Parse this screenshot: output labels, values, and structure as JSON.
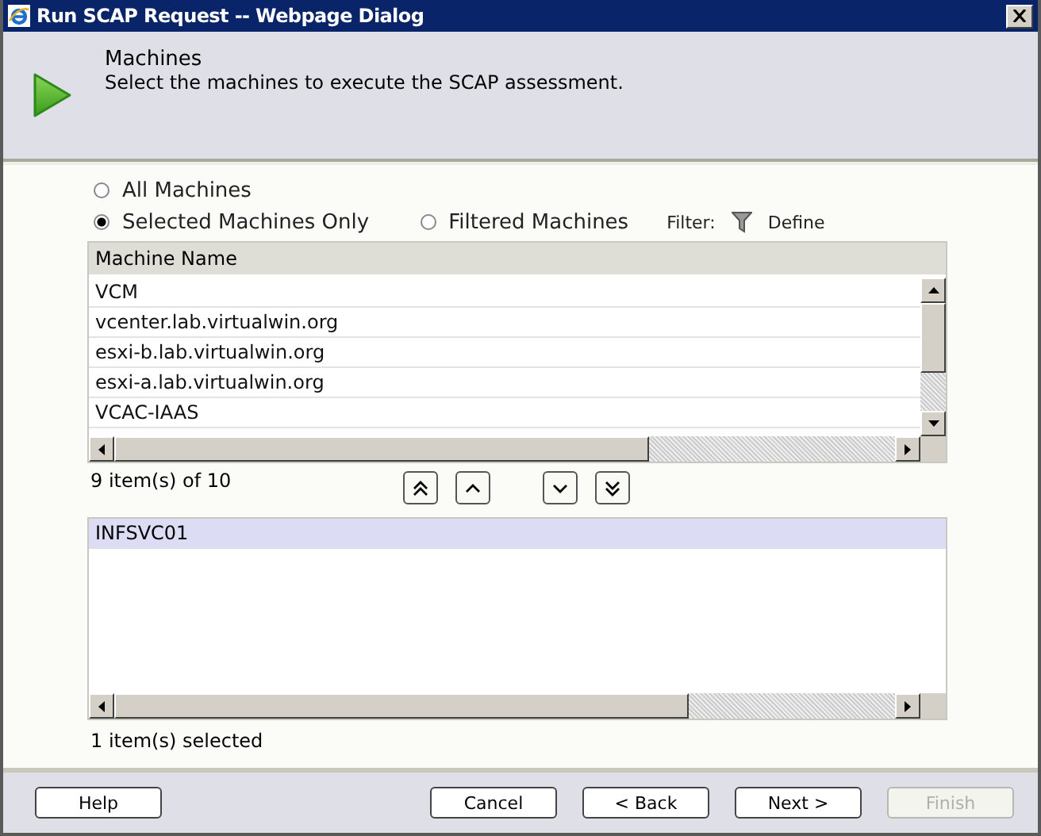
{
  "window": {
    "title": "Run SCAP Request -- Webpage Dialog"
  },
  "header": {
    "title": "Machines",
    "subtitle": "Select the machines to execute the SCAP assessment."
  },
  "scope_options": [
    {
      "label": "All Machines",
      "selected": false
    },
    {
      "label": "Selected Machines Only",
      "selected": true
    },
    {
      "label": "Filtered Machines",
      "selected": false
    }
  ],
  "filter": {
    "label": "Filter:",
    "link": "Define"
  },
  "table": {
    "columns": [
      "Machine Name"
    ],
    "rows": [
      {
        "name": "VCM"
      },
      {
        "name": "vcenter.lab.virtualwin.org"
      },
      {
        "name": "esxi-b.lab.virtualwin.org"
      },
      {
        "name": "esxi-a.lab.virtualwin.org"
      },
      {
        "name": "VCAC-IAAS"
      }
    ]
  },
  "available_count": "9 item(s) of 10",
  "move_buttons": [
    {
      "kind": "top"
    },
    {
      "kind": "up"
    },
    {
      "kind": "down"
    },
    {
      "kind": "bottom"
    }
  ],
  "selected_list": {
    "items": [
      {
        "name": "INFSVC01",
        "selected": true
      }
    ],
    "count": "1 item(s) selected"
  },
  "buttons": [
    {
      "label": "Help",
      "disabled": false
    },
    {
      "label": "Cancel",
      "disabled": false
    },
    {
      "label": "< Back",
      "disabled": false
    },
    {
      "label": "Next >",
      "disabled": false
    },
    {
      "label": "Finish",
      "disabled": true
    }
  ]
}
